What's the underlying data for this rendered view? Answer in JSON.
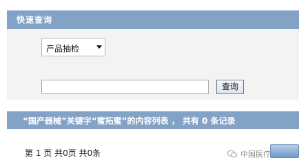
{
  "search_panel": {
    "title": "快速查询",
    "category_select": {
      "selected": "产品抽检"
    },
    "query_input": {
      "value": ""
    },
    "query_button_label": "查询"
  },
  "results": {
    "title": "“国产器械”关键字“蜜拓蜜”的内容列表 ， 共有 0 条记录",
    "pagination": "第 1 页 共0页 共0条"
  },
  "watermark": {
    "text": "中国医疗器械监控"
  },
  "colors": {
    "header_blue": "#82a2c6",
    "panel_bg": "#f3f3f3"
  }
}
